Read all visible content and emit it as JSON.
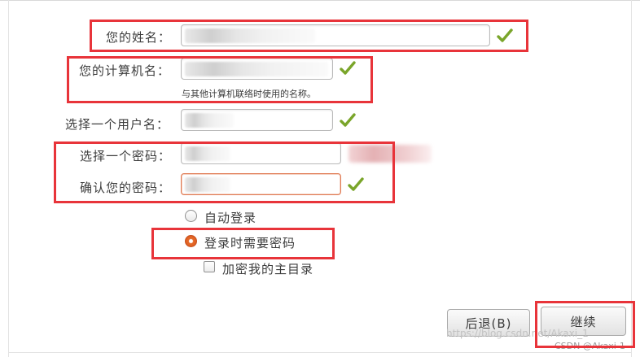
{
  "form": {
    "name_label": "您的姓名：",
    "computer_label": "您的计算机名：",
    "computer_hint": "与其他计算机联络时使用的名称。",
    "username_label": "选择一个用户名：",
    "password_label": "选择一个密码：",
    "confirm_label": "确认您的密码："
  },
  "options": {
    "auto_login": "自动登录",
    "require_password": "登录时需要密码",
    "encrypt_home": "加密我的主目录",
    "selected": "require_password"
  },
  "buttons": {
    "back": "后退(B)",
    "continue": "继续"
  },
  "watermark": {
    "url": "https://blog.csdn.net/Akaxi_1",
    "credit": "CSDN @Akaxi-1"
  },
  "colors": {
    "highlight": "#e8343a",
    "accent": "#e56a2b",
    "check": "#7aa52a"
  }
}
